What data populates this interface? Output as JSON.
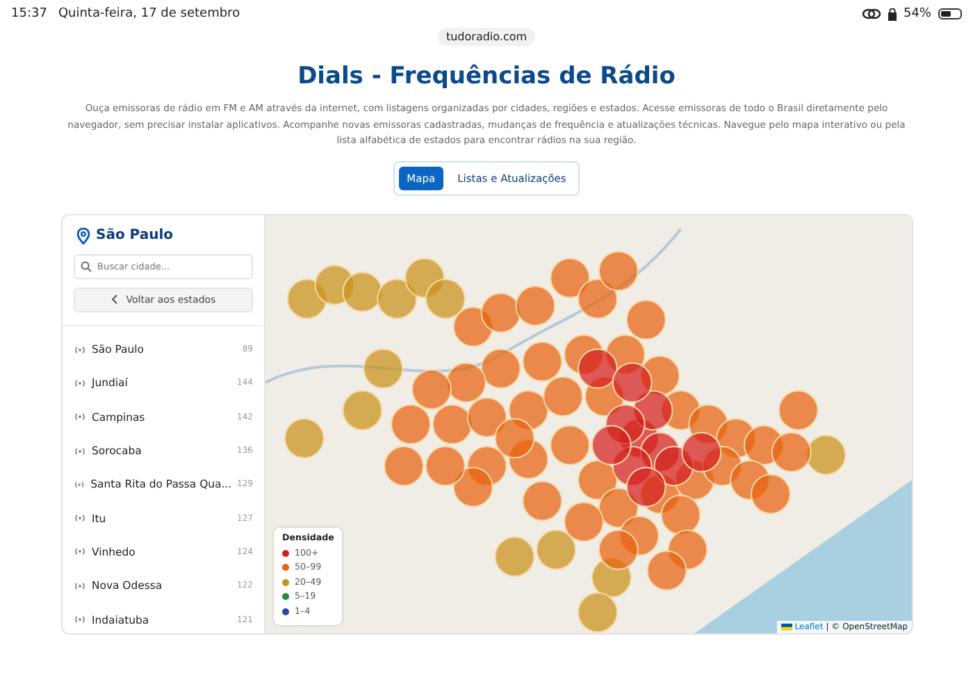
{
  "status_bar": {
    "time": "15:37",
    "date": "Quinta-feira, 17 de setembro",
    "battery": "54%",
    "battery_icon": {
      "level": 0.54
    }
  },
  "address_bar": {
    "url": "tudoradio.com"
  },
  "header": {
    "title": "Dials - Frequências de Rádio",
    "description": "Ouça emissoras de rádio em FM e AM através da internet, com listagens organizadas por cidades, regiões e estados. Acesse emissoras de todo o Brasil diretamente pelo navegador, sem precisar instalar aplicativos. Acompanhe novas emissoras cadastradas, mudanças de frequência e atualizações técnicas. Navegue pelo mapa interativo ou pela lista alfabética de estados para encontrar rádios na sua região."
  },
  "tabs": [
    {
      "label": "Mapa",
      "selected": true
    },
    {
      "label": "Listas e Atualizações",
      "selected": false
    }
  ],
  "sidebar": {
    "state": "São Paulo",
    "search": {
      "placeholder": "Buscar cidade..."
    },
    "back_button": "Voltar aos estados",
    "items": [
      {
        "name": "São Paulo",
        "count": "89"
      },
      {
        "name": "Jundiaí",
        "count": "144"
      },
      {
        "name": "Campinas",
        "count": "142"
      },
      {
        "name": "Sorocaba",
        "count": "136"
      },
      {
        "name": "Santa Rita do Passa Qua...",
        "count": "129"
      },
      {
        "name": "Itu",
        "count": "127"
      },
      {
        "name": "Vinhedo",
        "count": "124"
      },
      {
        "name": "Nova Odessa",
        "count": "122"
      },
      {
        "name": "Indaiatuba",
        "count": "121"
      }
    ]
  },
  "map": {
    "legend": {
      "title": "Densidade",
      "items": [
        {
          "label": "100+",
          "color": "#d42020"
        },
        {
          "label": "50–99",
          "color": "#e8620f"
        },
        {
          "label": "20–49",
          "color": "#c9921a"
        },
        {
          "label": "5–19",
          "color": "#238a3c"
        },
        {
          "label": "1–4",
          "color": "#2446b8"
        }
      ]
    },
    "attribution": {
      "link": "Leaflet",
      "text": "| © OpenStreetMap"
    }
  }
}
